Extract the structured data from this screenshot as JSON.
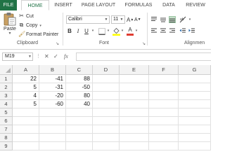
{
  "ribbon_tabs": [
    "FILE",
    "HOME",
    "INSERT",
    "PAGE LAYOUT",
    "FORMULAS",
    "DATA",
    "REVIEW"
  ],
  "clipboard": {
    "paste_label": "Paste",
    "cut_label": "Cut",
    "copy_label": "Copy",
    "format_painter_label": "Format Painter",
    "group_label": "Clipboard"
  },
  "font": {
    "name": "Calibri",
    "size": "11",
    "group_label": "Font",
    "bold": "B",
    "italic": "I",
    "underline": "U",
    "grow": "A",
    "shrink": "A",
    "font_color": "A"
  },
  "alignment": {
    "group_label": "Alignmen"
  },
  "formula_bar": {
    "name_box": "M19",
    "cancel": "✕",
    "enter": "✓",
    "fx": "fx",
    "formula": ""
  },
  "columns": [
    "A",
    "B",
    "C",
    "D",
    "E",
    "F",
    "G"
  ],
  "rows": [
    {
      "num": "1",
      "cells": [
        "22",
        "-41",
        "88",
        "",
        "",
        "",
        ""
      ]
    },
    {
      "num": "2",
      "cells": [
        "5",
        "-31",
        "-50",
        "",
        "",
        "",
        ""
      ]
    },
    {
      "num": "3",
      "cells": [
        "4",
        "-20",
        "80",
        "",
        "",
        "",
        ""
      ]
    },
    {
      "num": "4",
      "cells": [
        "5",
        "-60",
        "40",
        "",
        "",
        "",
        ""
      ]
    },
    {
      "num": "5",
      "cells": [
        "",
        "",
        "",
        "",
        "",
        "",
        ""
      ]
    },
    {
      "num": "6",
      "cells": [
        "",
        "",
        "",
        "",
        "",
        "",
        ""
      ]
    },
    {
      "num": "7",
      "cells": [
        "",
        "",
        "",
        "",
        "",
        "",
        ""
      ]
    },
    {
      "num": "8",
      "cells": [
        "",
        "",
        "",
        "",
        "",
        "",
        ""
      ]
    },
    {
      "num": "9",
      "cells": [
        "",
        "",
        "",
        "",
        "",
        "",
        ""
      ]
    }
  ],
  "colors": {
    "accent": "#217346",
    "font_color_bar": "#e03c31",
    "highlight_bar": "#ffff00",
    "selected_align": "#c5e0c9"
  }
}
